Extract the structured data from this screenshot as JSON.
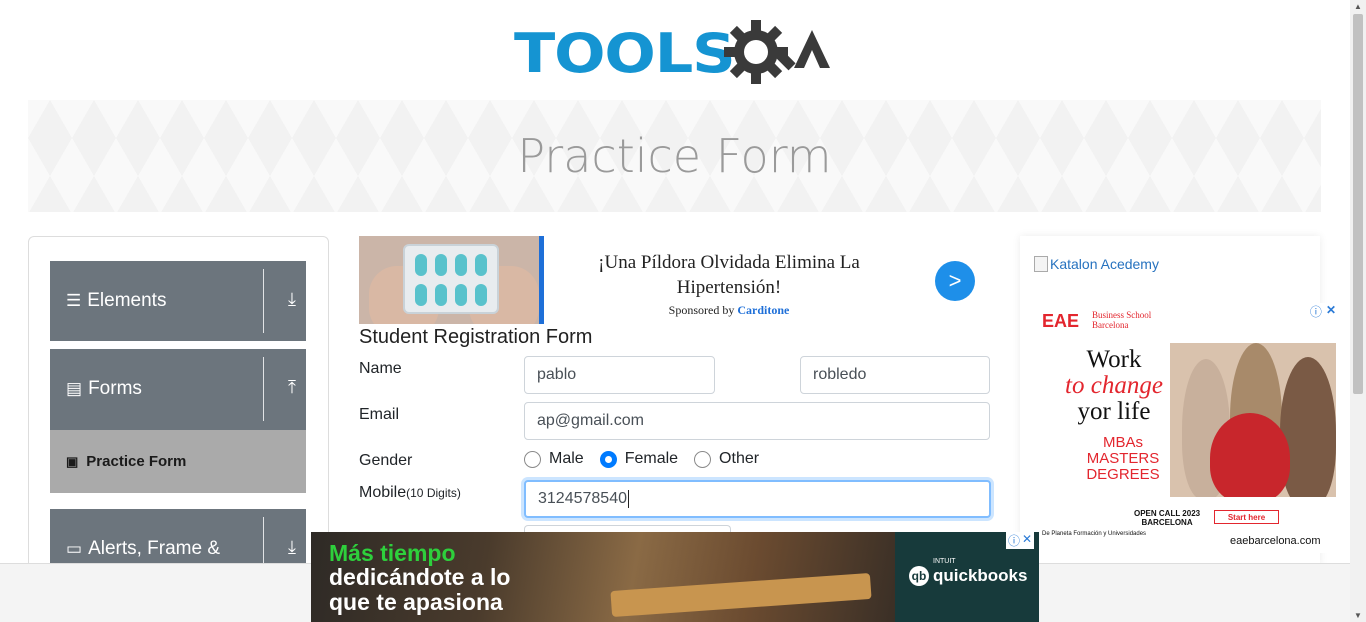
{
  "header": {
    "logo_text": "TOOLS",
    "logo_qa": "QA"
  },
  "banner": {
    "title": "Practice Form"
  },
  "sidebar": {
    "groups": [
      {
        "label": "Elements",
        "icon": "hamburger-icon",
        "arrow": "download-icon"
      },
      {
        "label": "Forms",
        "icon": "document-icon",
        "arrow": "upload-icon"
      },
      {
        "label": "Alerts, Frame &",
        "icon": "window-icon",
        "arrow": "download-icon"
      }
    ],
    "active_item": {
      "label": "Practice Form",
      "icon": "form-icon"
    }
  },
  "ad_top": {
    "headline": "¡Una Píldora Olvidada Elimina La Hipertensión!",
    "sponsor_prefix": "Sponsored by",
    "sponsor": "Carditone",
    "go": ">"
  },
  "form": {
    "title": "Student Registration Form",
    "name_label": "Name",
    "first_name": "pablo",
    "last_name": "robledo",
    "email_label": "Email",
    "email": "ap@gmail.com",
    "gender_label": "Gender",
    "gender_options": [
      "Male",
      "Female",
      "Other"
    ],
    "gender_selected": "Female",
    "mobile_label": "Mobile",
    "mobile_hint": "(10 Digits)",
    "mobile": "3124578540"
  },
  "right_ad": {
    "katalon": "Katalon Acedemy",
    "eae_logo": "EAE",
    "eae_sub1": "Business School",
    "eae_sub2": "Barcelona",
    "headline_1": "Work",
    "headline_2": "to change",
    "headline_3": "yor life",
    "programs": [
      "MBAs",
      "MASTERS",
      "DEGREES"
    ],
    "open_call": "OPEN CALL 2023",
    "city": "BARCELONA",
    "start_here": "Start here",
    "planeta": "De Planeta Formación y Universidades",
    "url": "eaebarcelona.com"
  },
  "bottom_ad": {
    "line1": "Más tiempo",
    "line2": "dedicándote a lo",
    "line3": "que te apasiona",
    "brand_small": "INTUIT",
    "brand": "quickbooks"
  },
  "colors": {
    "brand_blue": "#1594d2",
    "sidebar_gray": "#6c757d",
    "accent_blue": "#007bff",
    "qb_green": "#2ecf3c"
  }
}
